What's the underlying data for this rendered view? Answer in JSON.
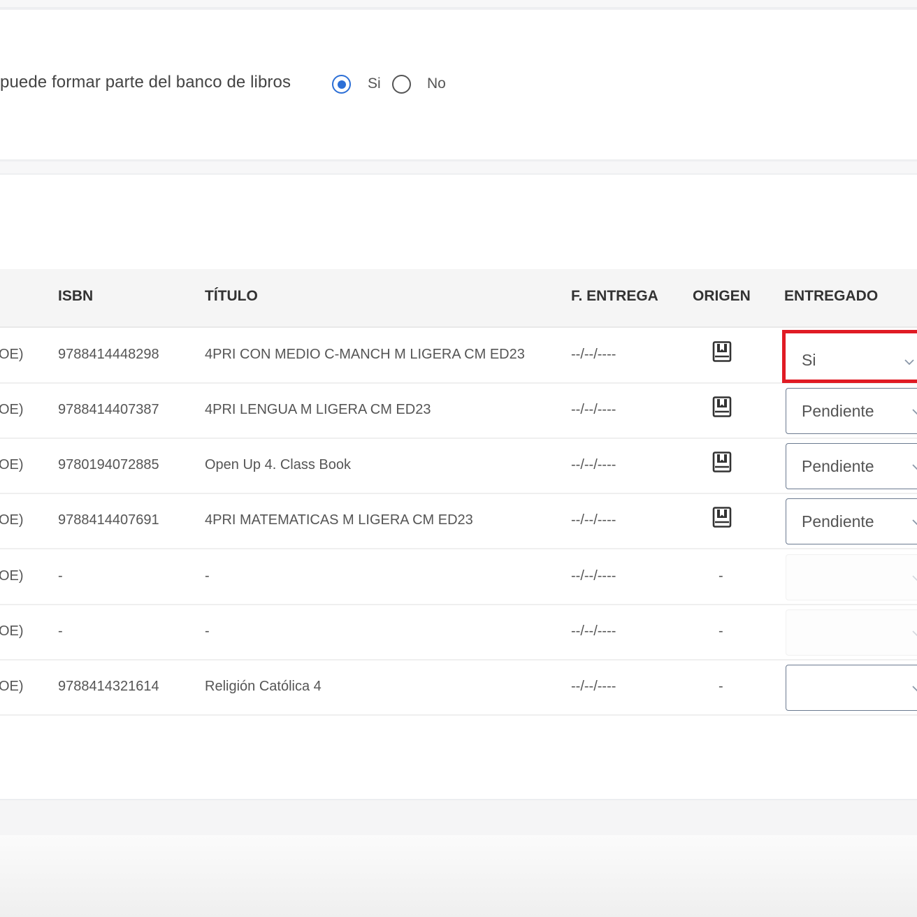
{
  "bank_question": {
    "label": "puede formar parte del banco de libros",
    "options": [
      "Si",
      "No"
    ],
    "selected": "Si"
  },
  "table": {
    "headers": {
      "isbn": "ISBN",
      "titulo": "TÍTULO",
      "fecha": "F. ENTREGA",
      "origen": "ORIGEN",
      "entregado": "ENTREGADO"
    },
    "rows": [
      {
        "prefix": "OE)",
        "isbn": "9788414448298",
        "titulo": "4PRI CON MEDIO C-MANCH M LIGERA CM ED23",
        "fecha": "--/--/----",
        "origen": "book-icon",
        "entregado": "Si"
      },
      {
        "prefix": "OE)",
        "isbn": "9788414407387",
        "titulo": "4PRI LENGUA M LIGERA CM ED23",
        "fecha": "--/--/----",
        "origen": "book-icon",
        "entregado": "Pendiente"
      },
      {
        "prefix": "OE)",
        "isbn": "9780194072885",
        "titulo": "Open Up 4. Class Book",
        "fecha": "--/--/----",
        "origen": "book-icon",
        "entregado": "Pendiente"
      },
      {
        "prefix": "OE)",
        "isbn": "9788414407691",
        "titulo": "4PRI MATEMATICAS M LIGERA CM ED23",
        "fecha": "--/--/----",
        "origen": "book-icon",
        "entregado": "Pendiente"
      },
      {
        "prefix": "OE)",
        "isbn": "-",
        "titulo": "-",
        "fecha": "--/--/----",
        "origen": "-",
        "entregado": ""
      },
      {
        "prefix": "OE)",
        "isbn": "-",
        "titulo": "-",
        "fecha": "--/--/----",
        "origen": "-",
        "entregado": ""
      },
      {
        "prefix": "OE)",
        "isbn": "9788414321614",
        "titulo": "Religión Católica 4",
        "fecha": "--/--/----",
        "origen": "-",
        "entregado": ""
      }
    ]
  },
  "colors": {
    "accent": "#2c6fd6",
    "highlight": "#e01b24"
  }
}
